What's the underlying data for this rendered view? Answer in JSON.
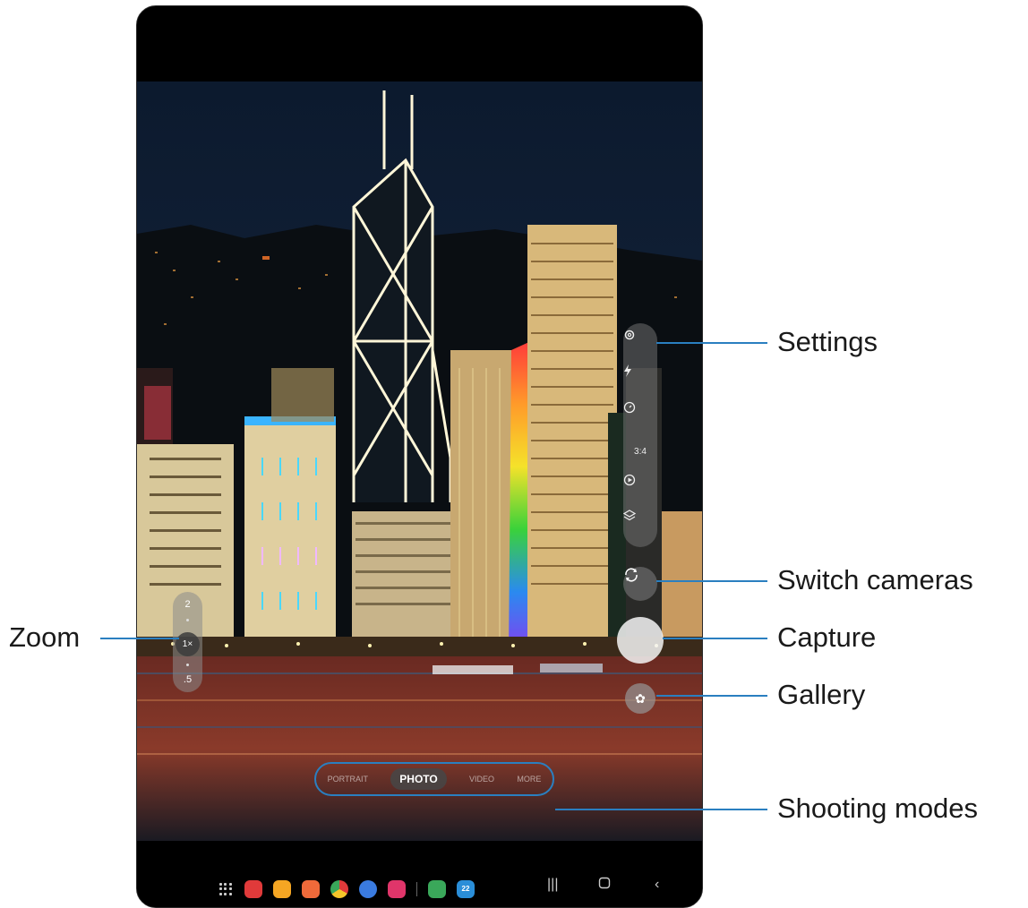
{
  "callouts": {
    "settings": "Settings",
    "switch_cameras": "Switch cameras",
    "capture": "Capture",
    "gallery": "Gallery",
    "shooting_modes": "Shooting modes",
    "zoom": "Zoom"
  },
  "zoom": {
    "top": "2",
    "active": "1×",
    "bottom": ".5"
  },
  "settings_toolbar": {
    "icons": [
      "gear-icon",
      "flash-icon",
      "timer-icon",
      "ratio-icon",
      "motion-photo-icon",
      "filters-icon"
    ],
    "ratio_label": "3:4"
  },
  "modes": {
    "items": [
      "PORTRAIT",
      "PHOTO",
      "VIDEO",
      "MORE"
    ],
    "active": "PHOTO"
  },
  "dock": {
    "apps": [
      {
        "icon": "flipboard-icon",
        "color": "#e03a3a"
      },
      {
        "icon": "my-files-icon",
        "color": "#f5a623"
      },
      {
        "icon": "contacts-icon",
        "color": "#f06a3a"
      },
      {
        "icon": "chrome-icon",
        "color": "#e8b330"
      },
      {
        "icon": "messages-icon",
        "color": "#3a7be0"
      },
      {
        "icon": "camera-icon",
        "color": "#e0356a"
      },
      {
        "icon": "calculator-icon",
        "color": "#3aa85a"
      },
      {
        "icon": "calendar-icon",
        "color": "#2a8ed8"
      }
    ],
    "calendar_day": "22"
  },
  "colors": {
    "callout_line": "#2a7fc0"
  }
}
